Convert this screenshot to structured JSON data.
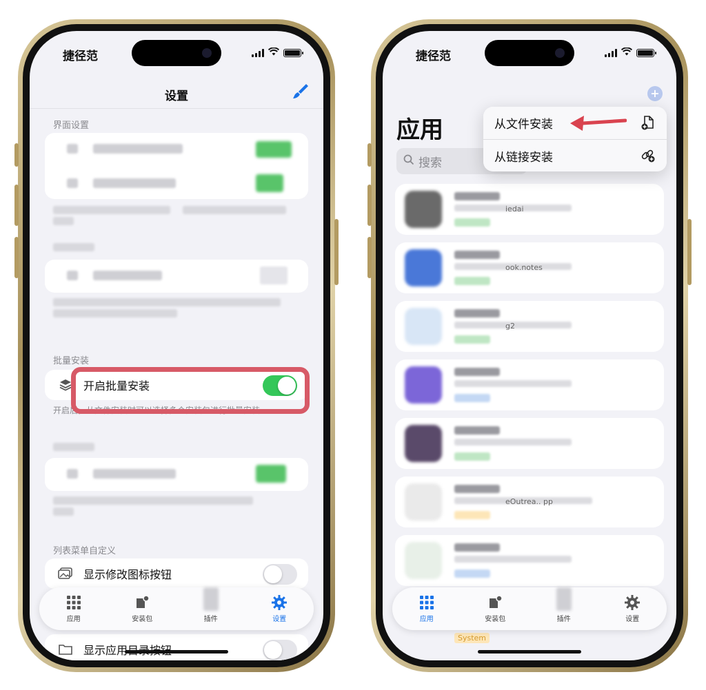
{
  "status": {
    "carrier": "捷径范"
  },
  "left": {
    "nav_title": "设置",
    "section_interface": "界面设置",
    "section_batch": "批量安装",
    "batch_toggle_label": "开启批量安装",
    "batch_footnote": "开启后，从文件安装时可以选择多个安装包进行批量安装。",
    "section_list_menu": "列表菜单自定义",
    "show_edit_icon_label": "显示修改图标按钮",
    "show_app_dir_label": "显示应用目录按钮",
    "tabs": [
      {
        "label": "应用",
        "icon": "grid-icon"
      },
      {
        "label": "安装包",
        "icon": "package-icon"
      },
      {
        "label": "插件",
        "icon": "puzzle-icon"
      },
      {
        "label": "设置",
        "icon": "gear-icon"
      }
    ]
  },
  "right": {
    "title": "应用",
    "search_placeholder": "搜索",
    "menu": [
      {
        "label": "从文件安装",
        "icon": "file-add-icon"
      },
      {
        "label": "从链接安装",
        "icon": "link-add-icon"
      }
    ],
    "apps": [
      {
        "sub": "iedai"
      },
      {
        "sub": "ook.notes"
      },
      {
        "sub": "g2"
      },
      {
        "sub": ""
      },
      {
        "sub": ""
      },
      {
        "sub": "eOutrea.. pp"
      },
      {
        "sub": ""
      }
    ],
    "system_badge": "System",
    "tabs": [
      {
        "label": "应用",
        "icon": "grid-icon"
      },
      {
        "label": "安装包",
        "icon": "package-icon"
      },
      {
        "label": "插件",
        "icon": "puzzle-icon"
      },
      {
        "label": "设置",
        "icon": "gear-icon"
      }
    ]
  },
  "colors": {
    "accent": "#1a73e8",
    "toggle_on": "#34c759",
    "highlight": "#d75a67",
    "arrow": "#d9434f"
  }
}
